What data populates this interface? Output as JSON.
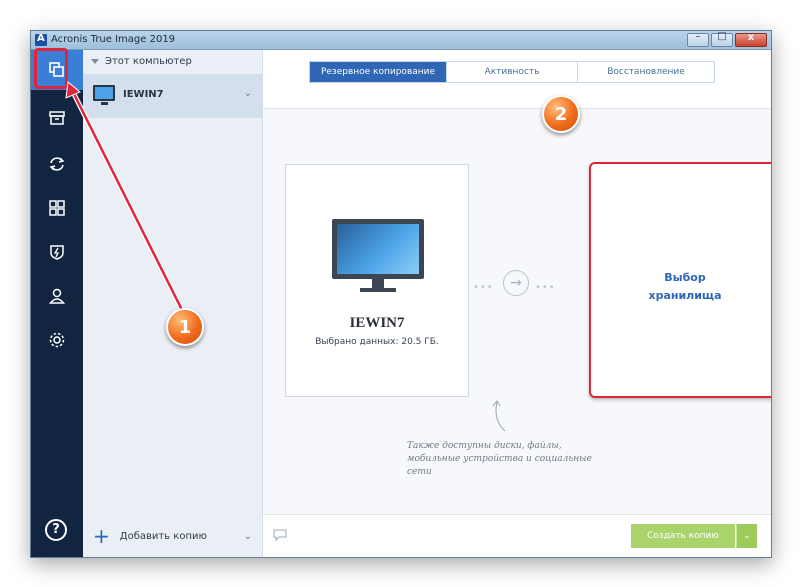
{
  "window": {
    "title": "Acronis True Image 2019"
  },
  "titlebar_buttons": {
    "minimize": "–",
    "maximize": "□",
    "close": "x"
  },
  "sidebar": {
    "items": [
      {
        "icon": "backup-copies-icon"
      },
      {
        "icon": "archive-icon"
      },
      {
        "icon": "sync-icon"
      },
      {
        "icon": "tools-grid-icon"
      },
      {
        "icon": "shield-icon"
      },
      {
        "icon": "account-icon"
      },
      {
        "icon": "settings-gear-icon"
      }
    ],
    "help_label": "?"
  },
  "left_panel": {
    "group_label": "Этот компьютер",
    "item_label": "IEWIN7",
    "item_chevron": "⌄",
    "add_copy_label": "Добавить копию",
    "add_plus": "+",
    "add_chevron": "⌄"
  },
  "tabs": [
    {
      "label": "Резервное копирование",
      "active": true
    },
    {
      "label": "Активность",
      "active": false
    },
    {
      "label": "Восстановление",
      "active": false
    }
  ],
  "source": {
    "name": "IEWIN7",
    "info": "Выбрано данных: 20.5 ГБ."
  },
  "flow": {
    "dots_left": "•••",
    "arrow": "→",
    "dots_right": "•••"
  },
  "destination": {
    "line1": "Выбор",
    "line2": "хранилища"
  },
  "hint": {
    "text": "Также доступны диски, файлы, мобильные устройства и социальные сети"
  },
  "bottom": {
    "create_label": "Создать копию",
    "dropdown_label": "⌄"
  },
  "annotations": {
    "badge1": "1",
    "badge2": "2",
    "color": "#e0243a",
    "badge_color": "#f26b1d"
  },
  "colors": {
    "accent": "#2f67b6",
    "rail": "#112540",
    "rail_active": "#3a7fd5",
    "create": "#a9d46b"
  }
}
